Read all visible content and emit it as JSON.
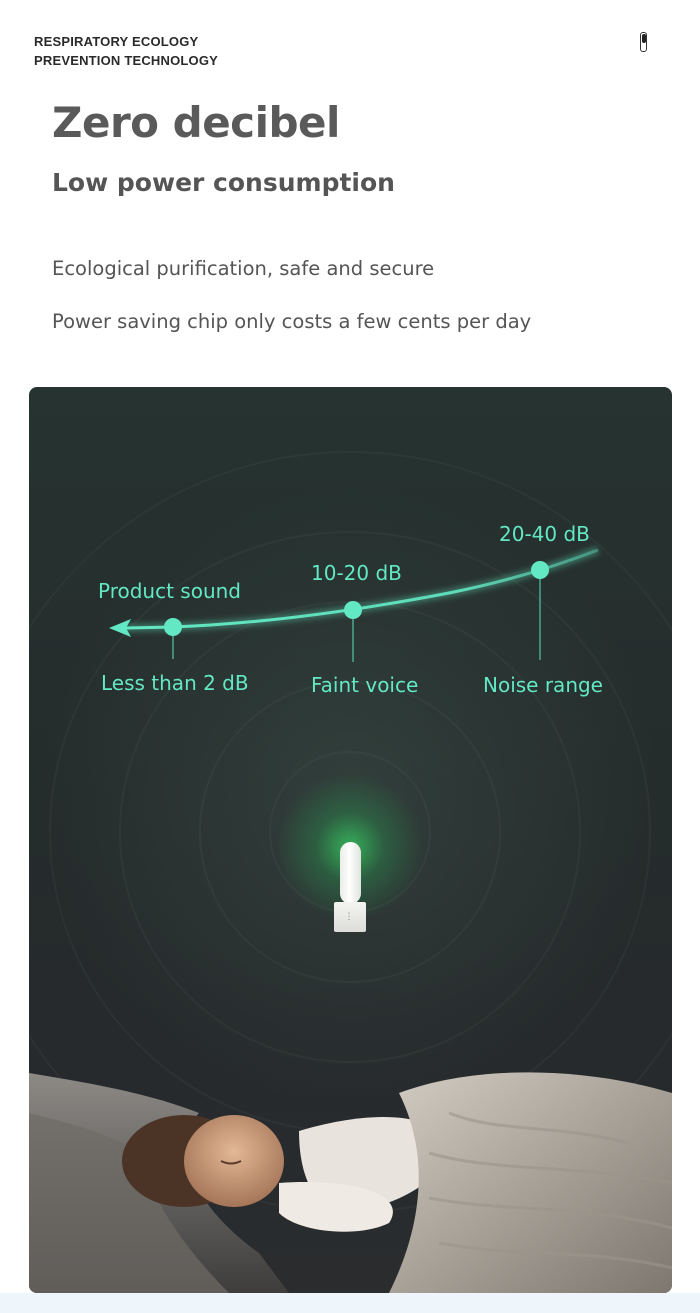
{
  "header": {
    "brand_line1": "RESPIRATORY ECOLOGY",
    "brand_line2": "PREVENTION TECHNOLOGY",
    "title": "Zero decibel",
    "subtitle": "Low power consumption",
    "features": [
      "Ecological purification, safe and secure",
      "Power saving chip only costs a few cents per day"
    ]
  },
  "sound_scale": {
    "points": [
      {
        "top_label": "Product sound",
        "bottom_label": "Less than 2 dB"
      },
      {
        "top_label": "10-20 dB",
        "bottom_label": "Faint voice"
      },
      {
        "top_label": "20-40 dB",
        "bottom_label": "Noise range"
      }
    ]
  },
  "colors": {
    "accent": "#62e8c3",
    "panel_background": "#262b2d",
    "heading": "#5a5a5a"
  },
  "icons": {
    "top_right": "battery-icon",
    "device": "plug-in-purifier-icon"
  }
}
